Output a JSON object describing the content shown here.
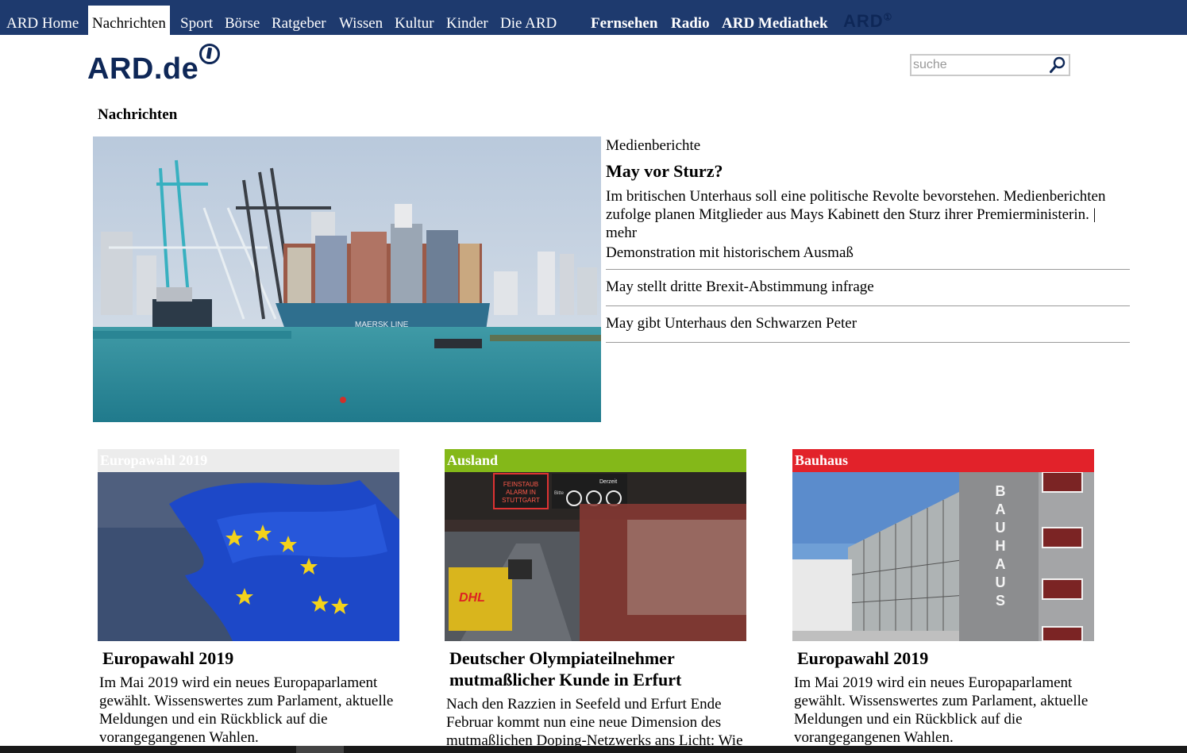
{
  "nav": {
    "items": [
      {
        "label": "ARD Home"
      },
      {
        "label": "Nachrichten"
      },
      {
        "label": "Sport"
      },
      {
        "label": "Börse"
      },
      {
        "label": "Ratgeber"
      },
      {
        "label": "Wissen"
      },
      {
        "label": "Kultur"
      },
      {
        "label": "Kinder"
      },
      {
        "label": "Die ARD"
      }
    ],
    "active": "Nachrichten",
    "right_items": [
      {
        "label": "Fernsehen"
      },
      {
        "label": "Radio"
      },
      {
        "label": "ARD Mediathek"
      }
    ],
    "brand_small": "ARD",
    "bar_color": "#1e3a6e"
  },
  "logo": {
    "text": "ARD.de",
    "color": "#0e2757"
  },
  "search": {
    "placeholder": "suche",
    "icon": "magnifier-icon"
  },
  "section_title": "Nachrichten",
  "hero": {
    "kicker": "Medienberichte",
    "title": "May vor Sturz?",
    "body": "Im britischen Unterhaus soll eine politische Revolte bevorstehen. Medienberichten zufolge planen Mitglieder aus Mays Kabinett den Sturz ihrer Premierministerin. |",
    "more": "mehr",
    "related": [
      "Demonstration mit historischem Ausmaß",
      "May stellt dritte Brexit-Abstimmung infrage",
      "May gibt Unterhaus den Schwarzen Peter"
    ]
  },
  "teasers": [
    {
      "category": "Europawahl 2019",
      "category_color": "#ececec",
      "title": "Europawahl 2019",
      "body": "Im Mai 2019 wird ein neues Europaparlament gewählt. Wissenswertes zum Parlament, aktuelle Meldungen und ein Rückblick auf die vorangegangenen Wahlen."
    },
    {
      "category": "Ausland",
      "category_color": "#84b819",
      "title": "Deutscher Olympiateilnehmer mutmaßlicher Kunde in Erfurt",
      "body": "Nach den Razzien in Seefeld und Erfurt Ende Februar kommt nun eine neue Dimension des mutmaßlichen Doping-Netzwerks ans Licht: Wie"
    },
    {
      "category": "Bauhaus",
      "category_color": "#e2222a",
      "title": "Europawahl 2019",
      "body": "Im Mai 2019 wird ein neues Europaparlament gewählt. Wissenswertes zum Parlament, aktuelle Meldungen und ein Rückblick auf die vorangegangenen Wahlen."
    }
  ],
  "image_text": {
    "feinstaub_sign": "FEINSTAUB ALARM IN STUTTGART",
    "derzeit": "Derzeit",
    "bitte": "Bitte",
    "dhl": "DHL",
    "bauhaus_sign": "BAUHAUS",
    "ship_name": "MAERSK LINE"
  }
}
